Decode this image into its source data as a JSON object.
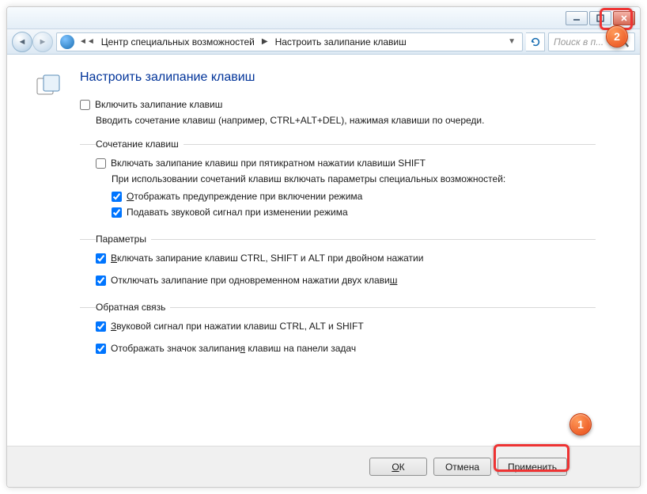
{
  "titlebar": {
    "minimize": "—",
    "maximize": "❐",
    "close": "✕"
  },
  "breadcrumb": {
    "segment1": "Центр специальных возможностей",
    "segment2": "Настроить залипание клавиш"
  },
  "search": {
    "placeholder": "Поиск в п..."
  },
  "page": {
    "title": "Настроить залипание клавиш",
    "enable_label": "Включить залипание клавиш",
    "enable_desc": "Вводить сочетание клавиш (например, CTRL+ALT+DEL), нажимая клавиши по очереди."
  },
  "group_shortcut": {
    "legend": "Сочетание клавиш",
    "five_shift": "Включать залипание клавиш при пятикратном нажатии клавиши SHIFT",
    "hotkey_desc": "При использовании сочетаний клавиш включать параметры специальных возможностей:",
    "warn": "тображать предупреждение при включении режима",
    "warn_u": "О",
    "sound": "Подавать звуковой сигнал при изменении режима"
  },
  "group_params": {
    "legend": "Параметры",
    "lock": "ключать запирание клавиш CTRL, SHIFT и ALT при двойном нажатии",
    "lock_u": "В",
    "off_two": "Отключать залипание при одновременном нажатии двух клави",
    "off_two_u": "ш"
  },
  "group_feedback": {
    "legend": "Обратная связь",
    "sound_mod": "вуковой сигнал при нажатии клавиш CTRL, ALT и SHIFT",
    "sound_mod_u": "З",
    "tray": "Отображать значок залипани",
    "tray_u": "я",
    "tray_tail": " клавиш на панели задач"
  },
  "footer": {
    "ok": "ОК",
    "ok_u": "О",
    "cancel": "Отмена",
    "apply": "Применить",
    "apply_u": "П"
  },
  "callout": {
    "one": "1",
    "two": "2"
  }
}
